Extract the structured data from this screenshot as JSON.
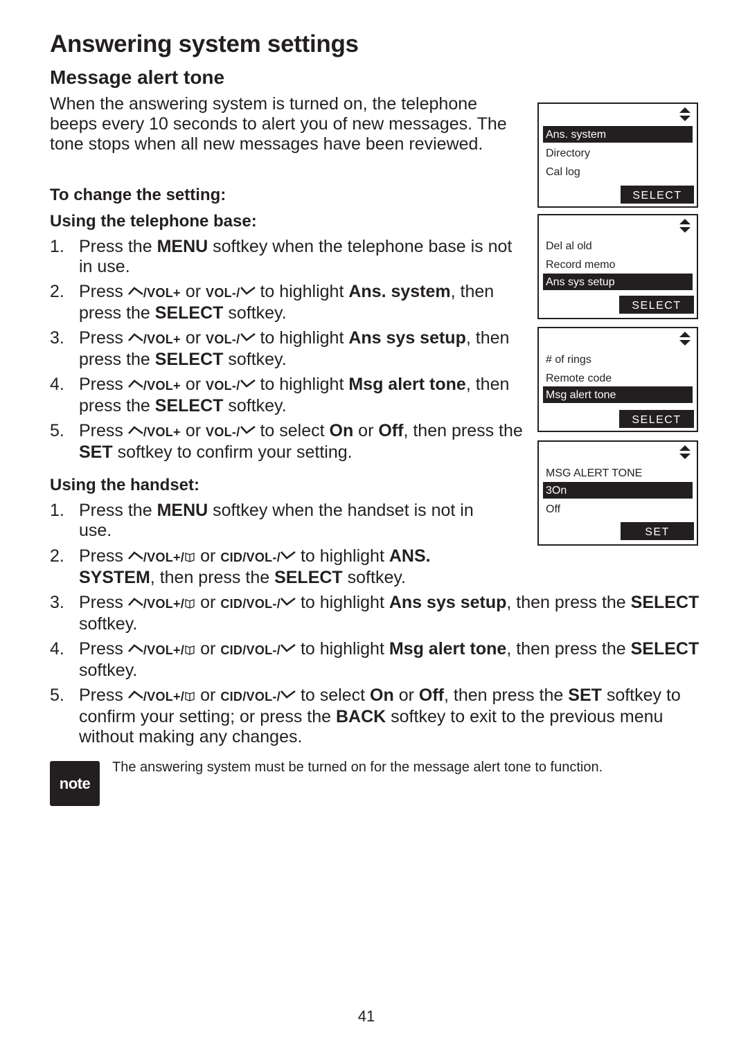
{
  "page": {
    "title": "Answering system settings",
    "section_title": "Message alert tone",
    "intro": "When the answering system is turned on, the telephone beeps every 10 seconds to alert you of new messages. The tone stops when all new messages have been reviewed.",
    "change_heading": "To change the setting:",
    "page_number": "41"
  },
  "keys": {
    "vol_plus": "/VOL+",
    "vol_minus": "VOL-/",
    "vol_plus_hs": "/VOL+/",
    "cid_vol_minus": "CID/VOL-/",
    "press": "Press",
    "or": "or"
  },
  "base": {
    "heading": "Using the telephone base:",
    "steps": [
      {
        "num": "1.",
        "pre": "Press the ",
        "b1": "MENU",
        "post": " softkey when the telephone base is not in use."
      },
      {
        "num": "2.",
        "mid": " to highlight ",
        "b1": "Ans. system",
        "p2": ", then press the ",
        "b2": "SELECT",
        "post": " softkey."
      },
      {
        "num": "3.",
        "mid": " to highlight ",
        "b1": "Ans sys setup",
        "p2": ", then press the ",
        "b2": "SELECT",
        "post": " softkey."
      },
      {
        "num": "4.",
        "mid": " to highlight ",
        "b1": "Msg alert tone",
        "p2": ", then press the ",
        "b2": "SELECT",
        "post": " softkey."
      },
      {
        "num": "5.",
        "mid": " to select ",
        "b1": "On",
        "p2": " or ",
        "b2": "Off",
        "p3": ", then press the ",
        "b3": "SET",
        "post": " softkey to confirm your setting."
      }
    ]
  },
  "handset": {
    "heading": "Using the handset:",
    "steps": [
      {
        "num": "1.",
        "pre": "Press the ",
        "b1": "MENU",
        "post": " softkey when the handset is not in use."
      },
      {
        "num": "2.",
        "mid": " to highlight ",
        "b1": "ANS. SYSTEM",
        "p2": ", then press the ",
        "b2": "SELECT",
        "post": " softkey."
      },
      {
        "num": "3.",
        "mid": " to highlight ",
        "b1": "Ans sys setup",
        "p2": ", then press the ",
        "b2": "SELECT",
        "post": " softkey."
      },
      {
        "num": "4.",
        "mid": " to highlight ",
        "b1": "Msg alert tone",
        "p2": ", then press the ",
        "b2": "SELECT",
        "post": " softkey."
      },
      {
        "num": "5.",
        "mid": " to select ",
        "b1": "On",
        "p2": " or ",
        "b2": "Off",
        "p3": ", then press the ",
        "b3": "SET",
        "p4": " softkey to confirm your setting; or press the ",
        "b4": "BACK",
        "post": " softkey to exit to the previous menu without making any changes."
      }
    ]
  },
  "screens": [
    {
      "rows": [
        "Ans. system",
        "Directory",
        "Cal log"
      ],
      "highlight": 0,
      "softkey": "SELECT"
    },
    {
      "rows": [
        "Del al old",
        "Record memo",
        "Ans sys setup"
      ],
      "highlight": 2,
      "softkey": "SELECT"
    },
    {
      "rows": [
        "# of rings",
        "Remote code",
        "Msg alert tone"
      ],
      "highlight": 2,
      "softkey": "SELECT"
    },
    {
      "rows": [
        "MSG ALERT TONE",
        "3On",
        "Off"
      ],
      "highlight": 1,
      "softkey": "SET"
    }
  ],
  "note": {
    "badge": "note",
    "text": "The answering system must be turned on for the message alert tone to function."
  }
}
